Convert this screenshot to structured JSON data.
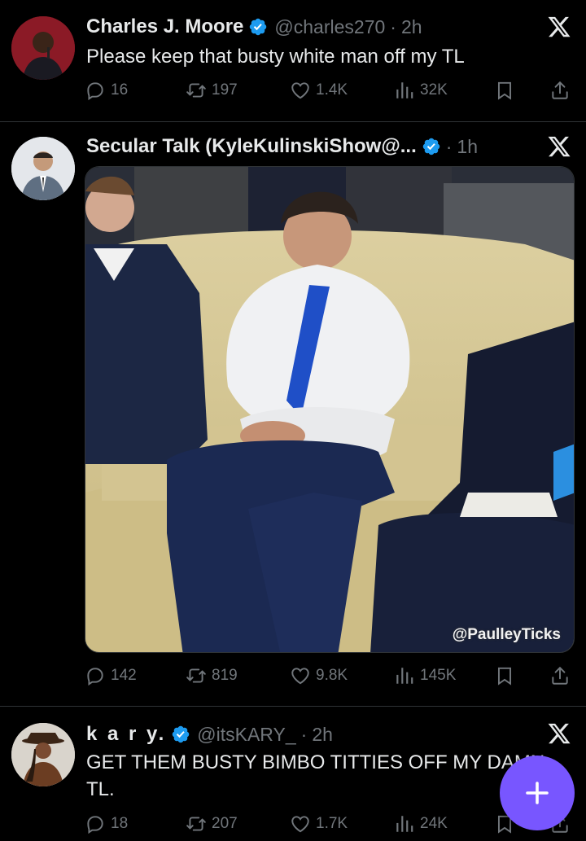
{
  "tweets": [
    {
      "name": "Charles J. Moore",
      "handle": "@charles270",
      "time": "2h",
      "text": "Please keep that busty white man off my TL",
      "replies": "16",
      "reposts": "197",
      "likes": "1.4K",
      "views": "32K"
    },
    {
      "name": "Secular Talk (KyleKulinskiShow@...",
      "handle": "",
      "time": "1h",
      "text": "",
      "media_watermark": "@PaulleyTicks",
      "replies": "142",
      "reposts": "819",
      "likes": "9.8K",
      "views": "145K"
    },
    {
      "name": "k a r y.",
      "handle": "@itsKARY_",
      "time": "2h",
      "text": "GET THEM BUSTY BIMBO TITTIES OFF MY DAMN TL.",
      "replies": "18",
      "reposts": "207",
      "likes": "1.7K",
      "views": "24K"
    }
  ],
  "icons": {
    "verified": "verified-badge-icon",
    "platform": "x-logo-icon",
    "reply": "reply-icon",
    "repost": "repost-icon",
    "like": "heart-icon",
    "views": "views-icon",
    "bookmark": "bookmark-icon",
    "share": "share-icon",
    "compose": "compose-plus-icon"
  },
  "colors": {
    "background": "#000000",
    "text": "#e7e9ea",
    "muted": "#71767b",
    "verified": "#1d9bf0",
    "fab": "#7856ff"
  }
}
